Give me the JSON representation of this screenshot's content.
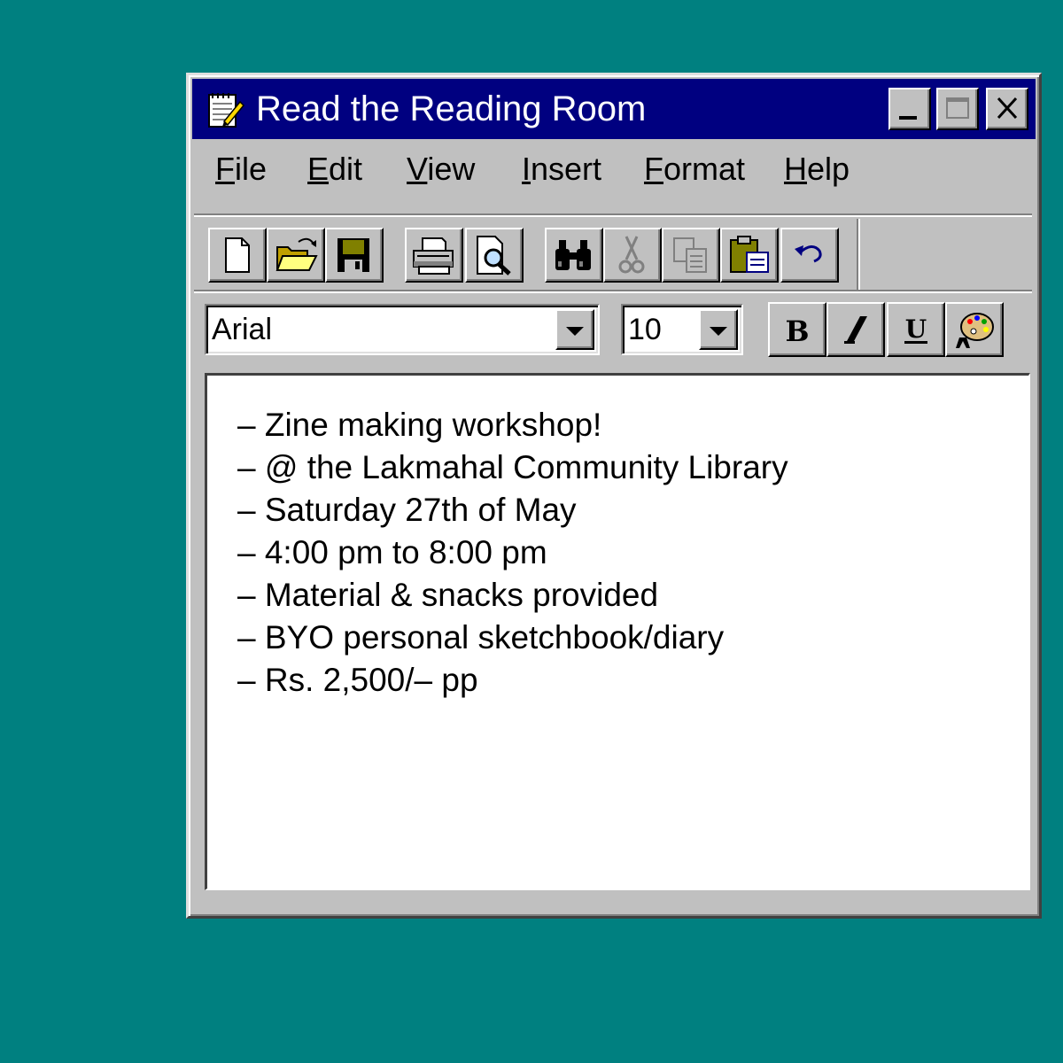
{
  "window": {
    "title": "Read the Reading Room"
  },
  "menu": [
    {
      "pre": "",
      "ul": "F",
      "post": "ile"
    },
    {
      "pre": "",
      "ul": "E",
      "post": "dit"
    },
    {
      "pre": "",
      "ul": "V",
      "post": "iew"
    },
    {
      "pre": "",
      "ul": "I",
      "post": "nsert"
    },
    {
      "pre": "",
      "ul": "F",
      "post": "ormat"
    },
    {
      "pre": "",
      "ul": "H",
      "post": "elp"
    }
  ],
  "toolbar": {
    "icons": [
      "new-document-icon",
      "open-folder-icon",
      "save-disk-icon",
      "print-icon",
      "print-preview-icon",
      "find-binoculars-icon",
      "cut-scissors-icon",
      "copy-icon",
      "paste-icon",
      "undo-icon"
    ]
  },
  "format_bar": {
    "font": "Arial",
    "size": "10",
    "bold_label": "B",
    "underline_label": "U"
  },
  "document": {
    "lines": [
      "– Zine making workshop!",
      "– @ the Lakmahal Community Library",
      "– Saturday 27th of May",
      "– 4:00 pm to 8:00 pm",
      "– Material & snacks provided",
      "– BYO personal sketchbook/diary",
      "– Rs. 2,500/– pp"
    ]
  },
  "colors": {
    "desktop": "#008080",
    "titlebar": "#000080",
    "chrome": "#c0c0c0"
  }
}
